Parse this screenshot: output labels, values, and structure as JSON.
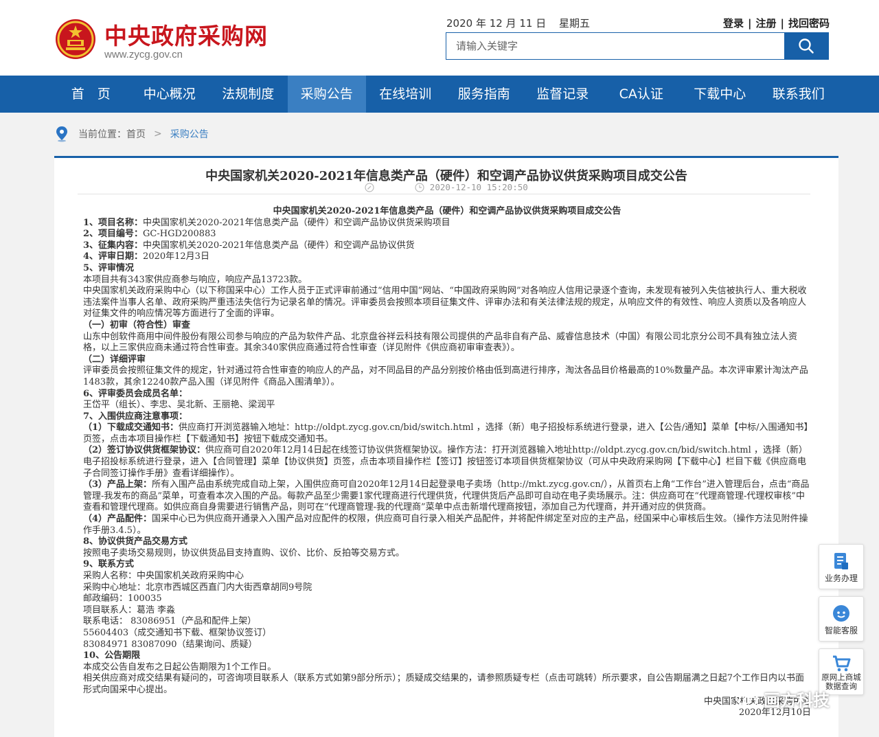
{
  "header": {
    "site_title": "中央政府采购网",
    "site_url": "www.zycg.gov.cn",
    "date": "2020 年 12 月 11 日",
    "weekday": "星期五",
    "login": "登录",
    "register": "注册",
    "find_password": "找回密码",
    "search_placeholder": "请输入关键字"
  },
  "nav": [
    "首　页",
    "中心概况",
    "法规制度",
    "采购公告",
    "在线培训",
    "服务指南",
    "监督记录",
    "CA认证",
    "下载中心",
    "联系我们"
  ],
  "nav_active": "采购公告",
  "breadcrumb": {
    "label": "当前位置：首页",
    "current": "采购公告"
  },
  "article": {
    "title": "中央国家机关2020-2021年信息类产品（硬件）和空调产品协议供货采购项目成交公告",
    "datetime": "2020-12-10 15:20:50",
    "heading": "中央国家机关2020-2021年信息类产品（硬件）和空调产品协议供货采购项目成交公告",
    "paragraphs": [
      {
        "b": "1、项目名称：",
        "t": "中央国家机关2020-2021年信息类产品（硬件）和空调产品协议供货采购项目"
      },
      {
        "b": "2、项目编号：",
        "t": "GC-HGD200883"
      },
      {
        "b": "3、征集内容：",
        "t": "中央国家机关2020-2021年信息类产品（硬件）和空调产品协议供货"
      },
      {
        "b": "4、评审日期：",
        "t": "2020年12月3日"
      },
      {
        "b": "5、评审情况",
        "t": ""
      },
      {
        "b": "",
        "t": "本项目共有343家供应商参与响应，响应产品13723款。"
      },
      {
        "b": "",
        "t": "中央国家机关政府采购中心（以下称国采中心）工作人员于正式评审前通过“信用中国”网站、“中国政府采购网”对各响应人信用记录逐个查询，未发现有被列入失信被执行人、重大税收违法案件当事人名单、政府采购严重违法失信行为记录名单的情况。评审委员会按照本项目征集文件、评审办法和有关法律法规的规定，从响应文件的有效性、响应人资质以及各响应人对征集文件的响应情况等方面进行了全面的评审。"
      },
      {
        "b": "（一）初审（符合性）审查",
        "t": ""
      },
      {
        "b": "",
        "t": "山东中创软件商用中间件股份有限公司参与响应的产品为软件产品、北京盘谷祥云科技有限公司提供的产品非自有产品、威睿信息技术（中国）有限公司北京分公司不具有独立法人资格，以上三家供应商未通过符合性审查。其余340家供应商通过符合性审查（详见附件《供应商初审审查表》）。"
      },
      {
        "b": "（二）详细评审",
        "t": ""
      },
      {
        "b": "",
        "t": "评审委员会按照征集文件的规定，针对通过符合性审查的响应人的产品，对不同品目的产品分别按价格由低到高进行排序，淘汰各品目价格最高的10%数量产品。本次评审累计淘汰产品1483款，其余12240款产品入围（详见附件《商品入围清单》）。"
      },
      {
        "b": "6、评审委员会成员名单：",
        "t": ""
      },
      {
        "b": "",
        "t": "王岱平（组长）、李忠、吴北新、王丽艳、梁润平"
      },
      {
        "b": "7、入围供应商注意事项：",
        "t": ""
      },
      {
        "b": "（1）下载成交通知书：",
        "t": "供应商打开浏览器输入地址：http://oldpt.zycg.gov.cn/bid/switch.html ，选择（新）电子招投标系统进行登录，进入【公告/通知】菜单【中标/入围通知书】页签，点击本项目操作栏【下载通知书】按钮下载成交通知书。"
      },
      {
        "b": "（2）签订协议供货框架协议：",
        "t": "供应商可自2020年12月14日起在线签订协议供货框架协议。操作方法：打开浏览器输入地址http://oldpt.zycg.gov.cn/bid/switch.html ，选择（新）电子招投标系统进行登录，进入【合同管理】菜单【协议供货】页签，点击本项目操作栏【签订】按钮签订本项目供货框架协议（可从中央政府采购网【下载中心】栏目下载《供应商电子合同签订操作手册》查看详细操作）。"
      },
      {
        "b": "（3）产品上架：",
        "t": "所有入围产品由系统完成自动上架，入围供应商可自2020年12月14日起登录电子卖场（http://mkt.zycg.gov.cn/），从首页右上角“工作台”进入管理后台，点击“商品管理-我发布的商品”菜单，可查看本次入围的产品。每款产品至少需要1家代理商进行代理供货，代理供货后产品即可自动在电子卖场展示。注：供应商可在“代理商管理-代理权审核”中查看和管理代理商。如供应商自身需要进行销售产品，则可在“代理商管理-我的代理商”菜单中点击新增代理商按钮，添加自己为代理商，并开通对应的供货商。"
      },
      {
        "b": "（4）产品配件：",
        "t": "国采中心已为供应商开通录入入围产品对应配件的权限，供应商可自行录入相关产品配件，并将配件绑定至对应的主产品，经国采中心审核后生效。（操作方法见附件操作手册3.4.5）。"
      },
      {
        "b": "8、协议供货产品交易方式",
        "t": ""
      },
      {
        "b": "",
        "t": "按照电子卖场交易规则，协议供货品目支持直购、议价、比价、反拍等交易方式。"
      },
      {
        "b": "9、联系方式",
        "t": ""
      },
      {
        "b": "",
        "t": "采购人名称：中央国家机关政府采购中心"
      },
      {
        "b": "",
        "t": "采购中心地址：北京市西城区西直门内大街西章胡同9号院"
      },
      {
        "b": "",
        "t": "邮政编码：100035"
      },
      {
        "b": "",
        "t": "项目联系人：葛浩 李淼"
      },
      {
        "b": "",
        "t": "联系电话： 83086951（产品和配件上架）"
      },
      {
        "b": "",
        "t": "55604403（成交通知书下载、框架协议签订）"
      },
      {
        "b": "",
        "t": "83084971 83087090（结果询问、质疑）"
      },
      {
        "b": "10、公告期限",
        "t": ""
      },
      {
        "b": "",
        "t": "本成交公告自发布之日起公告期限为1个工作日。"
      },
      {
        "b": "",
        "t": "相关供应商对成交结果有疑问的，可咨询项目联系人（联系方式如第9部分所示）；质疑成交结果的，请参照质疑专栏（点击可跳转）所示要求，自公告期届满之日起7个工作日内以书面形式向国采中心提出。"
      }
    ],
    "signature": "中央国家机关政府采购中心",
    "sign_date": "2020年12月10日"
  },
  "float_buttons": [
    "业务办理",
    "智能客服",
    "原网上商城数据查询"
  ],
  "watermark": "画方科技",
  "colors": {
    "brand_blue": "#1760a8",
    "nav_active": "#3a7fc2",
    "logo_red": "#c8161d"
  }
}
